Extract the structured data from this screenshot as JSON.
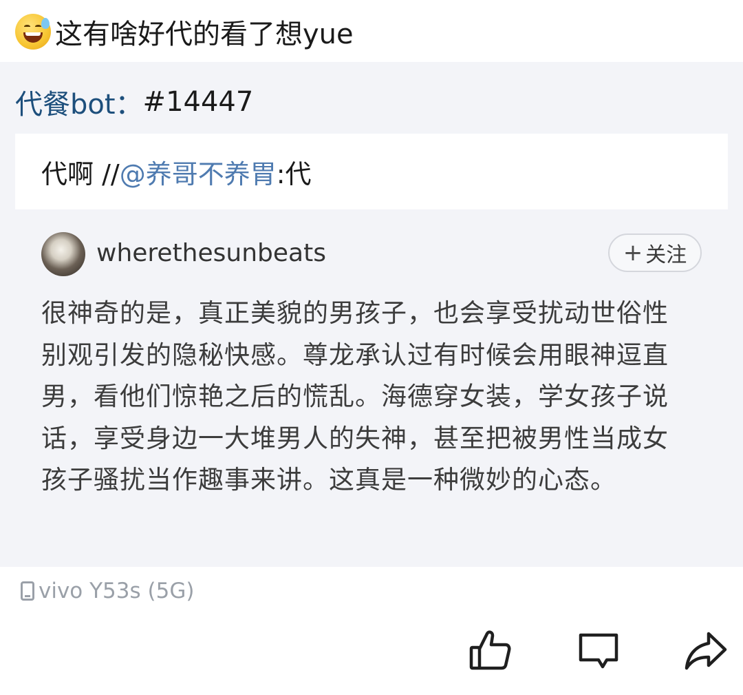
{
  "post": {
    "emoji": "sweat-smile-emoji",
    "text": "这有啥好代的看了想yue"
  },
  "repost": {
    "bot_name": "代餐bot：",
    "bot_tag": "#14447",
    "comment_prefix": "代啊 //",
    "mention": "@养哥不养胃",
    "comment_suffix": ":代"
  },
  "origin": {
    "username": "wherethesunbeats",
    "follow_plus": "+",
    "follow_label": "关注",
    "body": "很神奇的是，真正美貌的男孩子，也会享受扰动世俗性别观引发的隐秘快感。尊龙承认过有时候会用眼神逗直男，看他们惊艳之后的慌乱。海德穿女装，学女孩子说话，享受身边一大堆男人的失神，甚至把被男性当成女孩子骚扰当作趣事来讲。这真是一种微妙的心态。"
  },
  "device": {
    "label": "vivo Y53s (5G)",
    "icon": "phone-icon"
  },
  "actions": {
    "like_icon": "thumbs-up-icon",
    "comment_icon": "comment-bubble-icon",
    "share_icon": "share-arrow-icon"
  },
  "colors": {
    "repost_background": "#f3f4f8",
    "bot_name": "#1d4f7c",
    "mention": "#4f7bb0",
    "muted": "#9aa0a8"
  }
}
